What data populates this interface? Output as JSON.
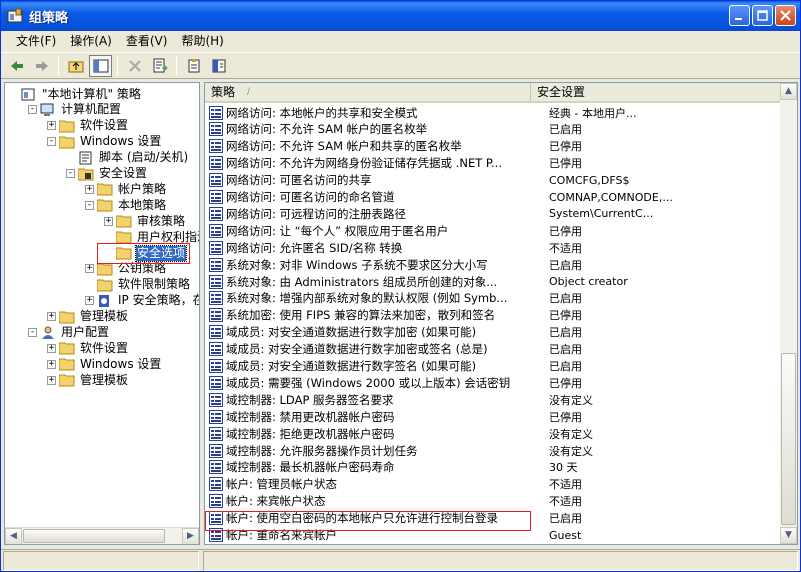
{
  "window": {
    "title": "组策略"
  },
  "menubar": [
    {
      "label": "文件(F)"
    },
    {
      "label": "操作(A)"
    },
    {
      "label": "查看(V)"
    },
    {
      "label": "帮助(H)"
    }
  ],
  "tree": [
    {
      "label": "\"本地计算机\" 策略",
      "level": 0,
      "exp": "none",
      "icon": "policy-icon"
    },
    {
      "label": "计算机配置",
      "level": 1,
      "exp": "-",
      "icon": "computer-icon"
    },
    {
      "label": "软件设置",
      "level": 2,
      "exp": "+",
      "icon": "folder-icon"
    },
    {
      "label": "Windows 设置",
      "level": 2,
      "exp": "-",
      "icon": "folder-icon"
    },
    {
      "label": "脚本 (启动/关机)",
      "level": 3,
      "exp": "none",
      "icon": "script-icon"
    },
    {
      "label": "安全设置",
      "level": 3,
      "exp": "-",
      "icon": "security-icon"
    },
    {
      "label": "帐户策略",
      "level": 4,
      "exp": "+",
      "icon": "folder-icon"
    },
    {
      "label": "本地策略",
      "level": 4,
      "exp": "-",
      "icon": "folder-icon"
    },
    {
      "label": "审核策略",
      "level": 5,
      "exp": "+",
      "icon": "folder-icon"
    },
    {
      "label": "用户权利指派",
      "level": 5,
      "exp": "none",
      "icon": "folder-icon"
    },
    {
      "label": "安全选项",
      "level": 5,
      "exp": "none",
      "icon": "folder-icon",
      "selected": true
    },
    {
      "label": "公钥策略",
      "level": 4,
      "exp": "+",
      "icon": "folder-icon"
    },
    {
      "label": "软件限制策略",
      "level": 4,
      "exp": "none",
      "icon": "folder-icon"
    },
    {
      "label": "IP 安全策略，在",
      "level": 4,
      "exp": "+",
      "icon": "ipsec-icon"
    },
    {
      "label": "管理模板",
      "level": 2,
      "exp": "+",
      "icon": "folder-icon"
    },
    {
      "label": "用户配置",
      "level": 1,
      "exp": "-",
      "icon": "user-icon"
    },
    {
      "label": "软件设置",
      "level": 2,
      "exp": "+",
      "icon": "folder-icon"
    },
    {
      "label": "Windows 设置",
      "level": 2,
      "exp": "+",
      "icon": "folder-icon"
    },
    {
      "label": "管理模板",
      "level": 2,
      "exp": "+",
      "icon": "folder-icon"
    }
  ],
  "list": {
    "columns": [
      "策略",
      "安全设置"
    ],
    "rows": [
      {
        "policy": "网络访问: 本地帐户的共享和安全模式",
        "setting": "经典 - 本地用户..."
      },
      {
        "policy": "网络访问: 不允许 SAM 帐户的匿名枚举",
        "setting": "已启用"
      },
      {
        "policy": "网络访问: 不允许 SAM 帐户和共享的匿名枚举",
        "setting": "已停用"
      },
      {
        "policy": "网络访问: 不允许为网络身份验证储存凭据或 .NET P...",
        "setting": "已停用"
      },
      {
        "policy": "网络访问: 可匿名访问的共享",
        "setting": "COMCFG,DFS$"
      },
      {
        "policy": "网络访问: 可匿名访问的命名管道",
        "setting": "COMNAP,COMNODE,..."
      },
      {
        "policy": "网络访问: 可远程访问的注册表路径",
        "setting": "System\\CurrentC..."
      },
      {
        "policy": "网络访问: 让 “每个人” 权限应用于匿名用户",
        "setting": "已停用"
      },
      {
        "policy": "网络访问: 允许匿名 SID/名称 转换",
        "setting": "不适用"
      },
      {
        "policy": "系统对象: 对非 Windows 子系统不要求区分大小写",
        "setting": "已启用"
      },
      {
        "policy": "系统对象: 由 Administrators 组成员所创建的对象...",
        "setting": "Object creator"
      },
      {
        "policy": "系统对象: 增强内部系统对象的默认权限 (例如 Symb...",
        "setting": "已启用"
      },
      {
        "policy": "系统加密: 使用 FIPS 兼容的算法来加密，散列和签名",
        "setting": "已停用"
      },
      {
        "policy": "域成员: 对安全通道数据进行数字加密 (如果可能)",
        "setting": "已启用"
      },
      {
        "policy": "域成员: 对安全通道数据进行数字加密或签名 (总是)",
        "setting": "已启用"
      },
      {
        "policy": "域成员: 对安全通道数据进行数字签名 (如果可能)",
        "setting": "已启用"
      },
      {
        "policy": "域成员: 需要强 (Windows 2000 或以上版本) 会话密钥",
        "setting": "已停用"
      },
      {
        "policy": "域控制器: LDAP 服务器签名要求",
        "setting": "没有定义"
      },
      {
        "policy": "域控制器: 禁用更改机器帐户密码",
        "setting": "已停用"
      },
      {
        "policy": "域控制器: 拒绝更改机器帐户密码",
        "setting": "没有定义"
      },
      {
        "policy": "域控制器: 允许服务器操作员计划任务",
        "setting": "没有定义"
      },
      {
        "policy": "域控制器: 最长机器帐户密码寿命",
        "setting": "30 天"
      },
      {
        "policy": "帐户: 管理员帐户状态",
        "setting": "不适用"
      },
      {
        "policy": "帐户: 来宾帐户状态",
        "setting": "不适用"
      },
      {
        "policy": "帐户: 使用空白密码的本地帐户只允许进行控制台登录",
        "setting": "已启用"
      },
      {
        "policy": "帐户: 重命名来宾帐户",
        "setting": "Guest"
      }
    ]
  },
  "colors": {
    "titlebar": "#0a5ae8",
    "selection": "#316ac5",
    "highlight_box": "#e02020"
  }
}
